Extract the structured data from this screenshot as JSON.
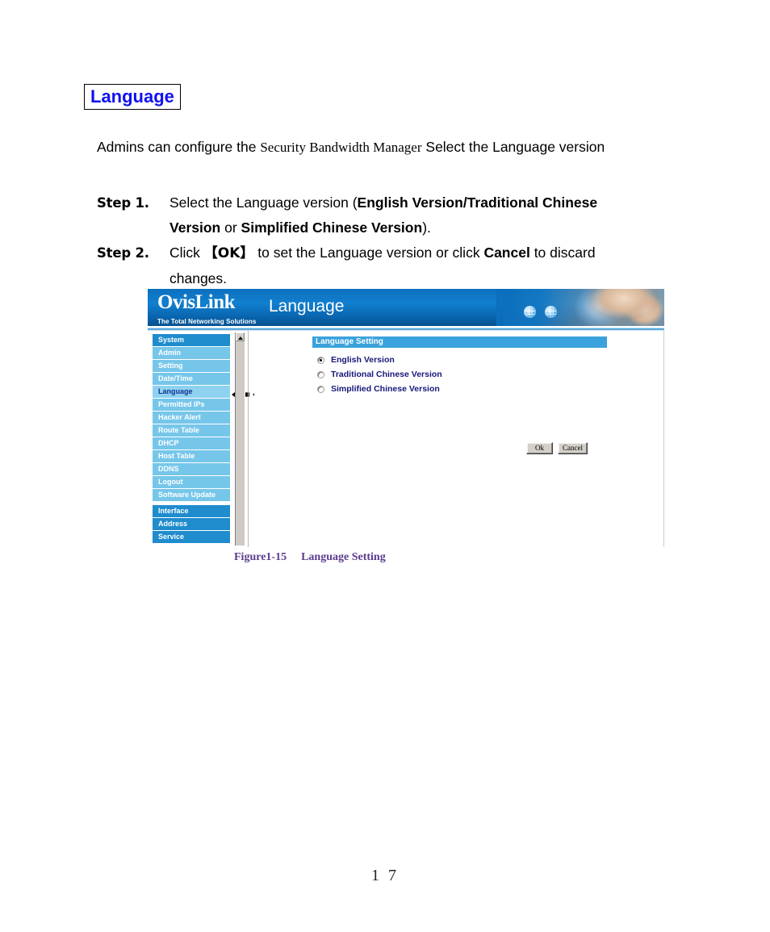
{
  "document": {
    "title": "Language",
    "title_color": "#1010f0",
    "intro": {
      "lead": "Admins can configure the ",
      "product": "Security Bandwidth Manager",
      "tail": " Select the Language version"
    },
    "steps": [
      {
        "label": "Step 1.",
        "line1_a": "Select the Language version (",
        "line1_b": "English Version/Traditional Chinese",
        "line2_a": "Version",
        "line2_b": " or ",
        "line2_c": "Simplified Chinese Version",
        "line2_d": ")."
      },
      {
        "label": "Step 2.",
        "line1_a": "Click  ",
        "line1_ok": "【OK】",
        "line1_b": " to set the Language version or click ",
        "line1_cancel": "Cancel",
        "line1_c": " to discard",
        "line2": "changes."
      }
    ],
    "figure_caption": {
      "number": "Figure1-15",
      "text": "Language Setting",
      "color": "#5b3a8e"
    },
    "page_number": "1 7"
  },
  "screenshot": {
    "banner": {
      "logo_word": "OvisLink",
      "logo_tagline": "The Total Networking Solutions",
      "page_title": "Language",
      "icons": [
        "globe-icon",
        "globe-icon"
      ],
      "accent_color": "#0c6fbd"
    },
    "sidebar": {
      "groups": [
        {
          "header": "System",
          "items": [
            "Admin",
            "Setting",
            "Date/Time",
            "Language",
            "Permitted IPs",
            "Hacker Alert",
            "Route Table",
            "DHCP",
            "Host Table",
            "DDNS",
            "Logout",
            "Software Update"
          ],
          "active_item": "Language"
        },
        {
          "header": "Interface",
          "items": []
        },
        {
          "header": "Address",
          "items": []
        },
        {
          "header": "Service",
          "items": []
        }
      ],
      "section_color": "#1f8ccd",
      "item_color": "#76c6ea",
      "active_color": "#8ed2f0",
      "active_text_color": "#13308f"
    },
    "panel": {
      "header": "Language Setting",
      "header_color": "#3aa2dc",
      "options": [
        {
          "label": "English Version",
          "selected": true
        },
        {
          "label": "Traditional Chinese Version",
          "selected": false
        },
        {
          "label": "Simplified Chinese Version",
          "selected": false
        }
      ],
      "buttons": [
        {
          "label": "Ok"
        },
        {
          "label": "Cancel"
        }
      ]
    },
    "annotation": {
      "arrows": 2,
      "points_to": "Language"
    },
    "scrollbar": {
      "present": true,
      "position": "top"
    }
  }
}
